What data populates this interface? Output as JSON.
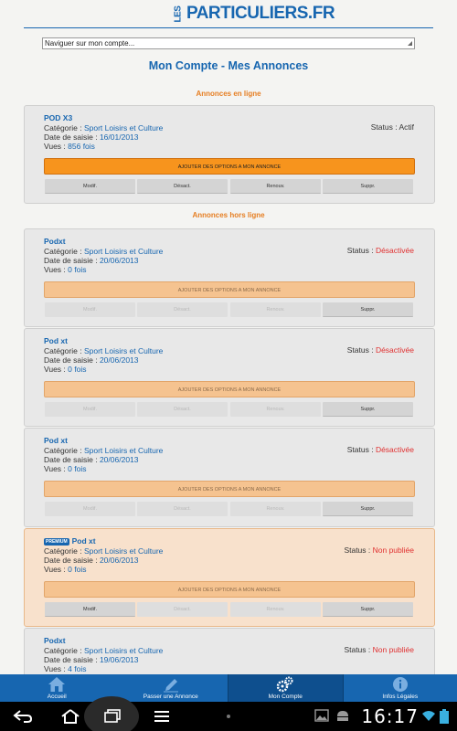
{
  "header": {
    "logo_small": "LES",
    "logo_main": "PARTICULIERS.FR"
  },
  "nav": {
    "placeholder": "Naviguer sur mon compte..."
  },
  "title": "Mon Compte - Mes Annonces",
  "sections": {
    "online": "Annonces en ligne",
    "offline": "Annonces hors ligne"
  },
  "labels": {
    "category": "Catégorie : ",
    "date": "Date de saisie : ",
    "views": "Vues : ",
    "status": "Status : ",
    "options": "AJOUTER DES OPTIONS A MON ANNONCE"
  },
  "buttons": {
    "modif": "Modif.",
    "desact": "Désact.",
    "renouv": "Renouv.",
    "suppr": "Suppr."
  },
  "ads": [
    {
      "name": "POD X3",
      "category": "Sport Loisirs et Culture",
      "date": "16/01/2013",
      "views": "856 fois",
      "status": "Actif",
      "premium": ""
    },
    {
      "name": "Podxt",
      "category": "Sport Loisirs et Culture",
      "date": "20/06/2013",
      "views": "0 fois",
      "status": "Désactivée",
      "premium": ""
    },
    {
      "name": "Pod xt",
      "category": "Sport Loisirs et Culture",
      "date": "20/06/2013",
      "views": "0 fois",
      "status": "Désactivée",
      "premium": ""
    },
    {
      "name": "Pod xt",
      "category": "Sport Loisirs et Culture",
      "date": "20/06/2013",
      "views": "0 fois",
      "status": "Désactivée",
      "premium": ""
    },
    {
      "name": "Pod xt",
      "category": "Sport Loisirs et Culture",
      "date": "20/06/2013",
      "views": "0 fois",
      "status": "Non publiée",
      "premium": "PREMIUM"
    },
    {
      "name": "Podxt",
      "category": "Sport Loisirs et Culture",
      "date": "19/06/2013",
      "views": "4 fois",
      "status": "Non publiée",
      "premium": ""
    }
  ],
  "tabs": [
    {
      "label": "Accueil",
      "icon": "home-icon"
    },
    {
      "label": "Passer une Annonce",
      "icon": "pencil-icon"
    },
    {
      "label": "Mon Compte",
      "icon": "gears-icon"
    },
    {
      "label": "Infos Légales",
      "icon": "info-icon"
    }
  ],
  "system": {
    "time": "16:17"
  },
  "colors": {
    "brand": "#1766b0",
    "orange": "#f7941d",
    "red": "#e03030",
    "section": "#e67e22"
  }
}
